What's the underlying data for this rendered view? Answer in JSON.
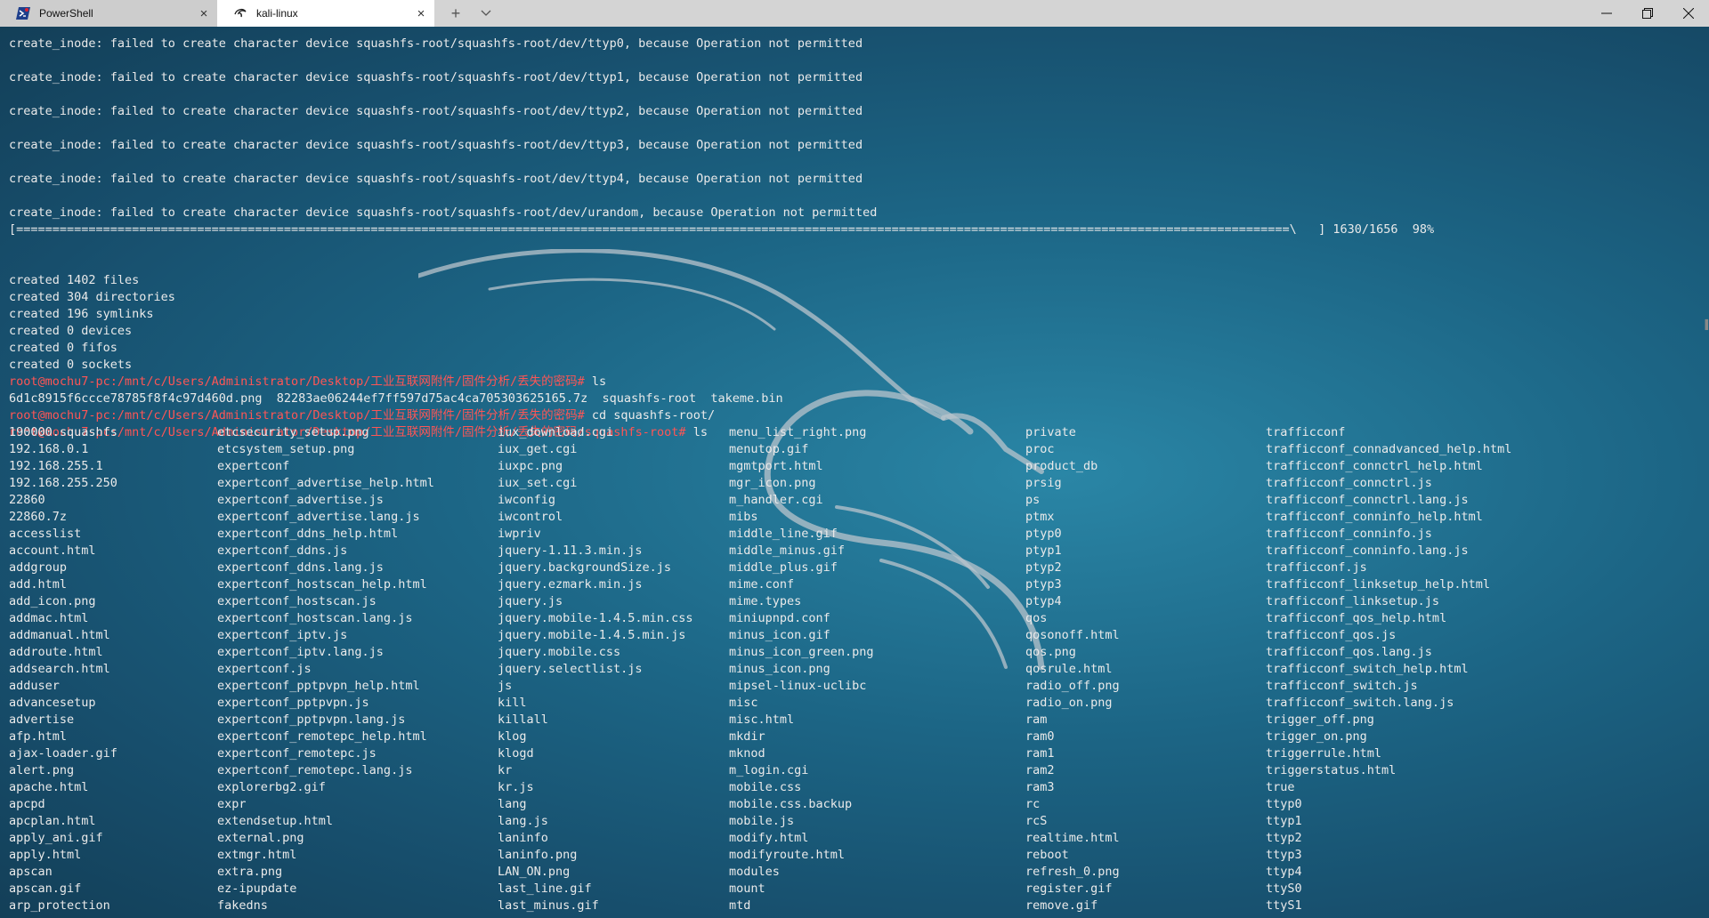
{
  "tabs": [
    {
      "label": "PowerShell",
      "icon": "powershell-icon",
      "active": false
    },
    {
      "label": "kali-linux",
      "icon": "kali-icon",
      "active": true
    }
  ],
  "window": {
    "minimize": "–",
    "maximize": "❐",
    "close": "✕"
  },
  "terminal": {
    "errors": [
      "create_inode: failed to create character device squashfs-root/squashfs-root/dev/ttyp0, because Operation not permitted",
      "create_inode: failed to create character device squashfs-root/squashfs-root/dev/ttyp1, because Operation not permitted",
      "create_inode: failed to create character device squashfs-root/squashfs-root/dev/ttyp2, because Operation not permitted",
      "create_inode: failed to create character device squashfs-root/squashfs-root/dev/ttyp3, because Operation not permitted",
      "create_inode: failed to create character device squashfs-root/squashfs-root/dev/ttyp4, because Operation not permitted",
      "create_inode: failed to create character device squashfs-root/squashfs-root/dev/urandom, because Operation not permitted"
    ],
    "progress": {
      "bar": "[================================================================================================================================================================================\\",
      "count": "] 1630/1656",
      "percent": "98%"
    },
    "summary": [
      "created 1402 files",
      "created 304 directories",
      "created 196 symlinks",
      "created 0 devices",
      "created 0 fifos",
      "created 0 sockets"
    ],
    "commands": [
      {
        "prompt": "root@mochu7-pc:/mnt/c/Users/Administrator/Desktop/工业互联网附件/固件分析/丢失的密码#",
        "cmd": " ls"
      },
      {
        "output": "6d1c8915f6ccce78785f8f4c97d460d.png  82283ae06244ef7ff597d75ac4ca705303625165.7z  squashfs-root  takeme.bin"
      },
      {
        "prompt": "root@mochu7-pc:/mnt/c/Users/Administrator/Desktop/工业互联网附件/固件分析/丢失的密码#",
        "cmd": " cd squashfs-root/"
      },
      {
        "prompt": "root@mochu7-pc:/mnt/c/Users/Administrator/Desktop/工业互联网附件/固件分析/丢失的密码/squashfs-root#",
        "cmd": " ls"
      }
    ],
    "listing": [
      [
        "190000.squashfs",
        "192.168.0.1",
        "192.168.255.1",
        "192.168.255.250",
        "22860",
        "22860.7z",
        "accesslist",
        "account.html",
        "addgroup",
        "add.html",
        "add_icon.png",
        "addmac.html",
        "addmanual.html",
        "addroute.html",
        "addsearch.html",
        "adduser",
        "advancesetup",
        "advertise",
        "afp.html",
        "ajax-loader.gif",
        "alert.png",
        "apache.html",
        "apcpd",
        "apcplan.html",
        "apply_ani.gif",
        "apply.html",
        "apscan",
        "apscan.gif",
        "arp_protection"
      ],
      [
        "etcsecurity_setup.png",
        "etcsystem_setup.png",
        "expertconf",
        "expertconf_advertise_help.html",
        "expertconf_advertise.js",
        "expertconf_advertise.lang.js",
        "expertconf_ddns_help.html",
        "expertconf_ddns.js",
        "expertconf_ddns.lang.js",
        "expertconf_hostscan_help.html",
        "expertconf_hostscan.js",
        "expertconf_hostscan.lang.js",
        "expertconf_iptv.js",
        "expertconf_iptv.lang.js",
        "expertconf.js",
        "expertconf_pptpvpn_help.html",
        "expertconf_pptpvpn.js",
        "expertconf_pptpvpn.lang.js",
        "expertconf_remotepc_help.html",
        "expertconf_remotepc.js",
        "expertconf_remotepc.lang.js",
        "explorerbg2.gif",
        "expr",
        "extendsetup.html",
        "external.png",
        "extmgr.html",
        "extra.png",
        "ez-ipupdate",
        "fakedns"
      ],
      [
        "iux_download.cgi",
        "iux_get.cgi",
        "iuxpc.png",
        "iux_set.cgi",
        "iwconfig",
        "iwcontrol",
        "iwpriv",
        "jquery-1.11.3.min.js",
        "jquery.backgroundSize.js",
        "jquery.ezmark.min.js",
        "jquery.js",
        "jquery.mobile-1.4.5.min.css",
        "jquery.mobile-1.4.5.min.js",
        "jquery.mobile.css",
        "jquery.selectlist.js",
        "js",
        "kill",
        "killall",
        "klog",
        "klogd",
        "kr",
        "kr.js",
        "lang",
        "lang.js",
        "laninfo",
        "laninfo.png",
        "LAN_ON.png",
        "last_line.gif",
        "last_minus.gif"
      ],
      [
        "menu_list_right.png",
        "menutop.gif",
        "mgmtport.html",
        "mgr_icon.png",
        "m_handler.cgi",
        "mibs",
        "middle_line.gif",
        "middle_minus.gif",
        "middle_plus.gif",
        "mime.conf",
        "mime.types",
        "miniupnpd.conf",
        "minus_icon.gif",
        "minus_icon_green.png",
        "minus_icon.png",
        "mipsel-linux-uclibc",
        "misc",
        "misc.html",
        "mkdir",
        "mknod",
        "m_login.cgi",
        "mobile.css",
        "mobile.css.backup",
        "mobile.js",
        "modify.html",
        "modifyroute.html",
        "modules",
        "mount",
        "mtd"
      ],
      [
        "private",
        "proc",
        "product_db",
        "prsig",
        "ps",
        "ptmx",
        "ptyp0",
        "ptyp1",
        "ptyp2",
        "ptyp3",
        "ptyp4",
        "qos",
        "qosonoff.html",
        "qos.png",
        "qosrule.html",
        "radio_off.png",
        "radio_on.png",
        "ram",
        "ram0",
        "ram1",
        "ram2",
        "ram3",
        "rc",
        "rcS",
        "realtime.html",
        "reboot",
        "refresh_0.png",
        "register.gif",
        "remove.gif"
      ],
      [
        "trafficconf",
        "trafficconf_connadvanced_help.html",
        "trafficconf_connctrl_help.html",
        "trafficconf_connctrl.js",
        "trafficconf_connctrl.lang.js",
        "trafficconf_conninfo_help.html",
        "trafficconf_conninfo.js",
        "trafficconf_conninfo.lang.js",
        "trafficconf.js",
        "trafficconf_linksetup_help.html",
        "trafficconf_linksetup.js",
        "trafficconf_qos_help.html",
        "trafficconf_qos.js",
        "trafficconf_qos.lang.js",
        "trafficconf_switch_help.html",
        "trafficconf_switch.js",
        "trafficconf_switch.lang.js",
        "trigger_off.png",
        "trigger_on.png",
        "triggerrule.html",
        "triggerstatus.html",
        "true",
        "ttyp0",
        "ttyp1",
        "ttyp2",
        "ttyp3",
        "ttyp4",
        "ttyS0",
        "ttyS1"
      ]
    ]
  },
  "colors": {
    "prompt": "#ff5555",
    "text": "#eaeaea",
    "titlebar": "#d4d4d4"
  }
}
